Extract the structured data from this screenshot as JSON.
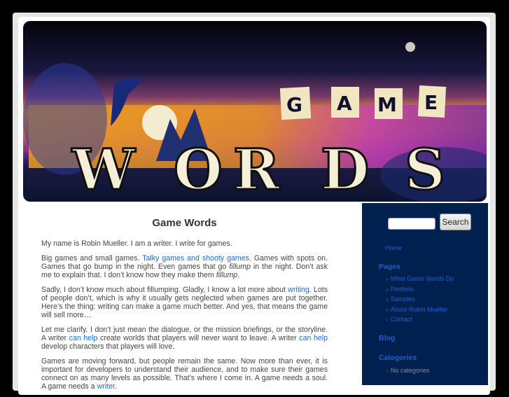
{
  "header": {
    "logo_game_letters": [
      "G",
      "A",
      "M",
      "E"
    ],
    "logo_words": "WORDS"
  },
  "content": {
    "title": "Game Words",
    "p1": "My name is Robin Mueller. I am a writer. I write for games.",
    "p2": {
      "a": "Big games and small games. ",
      "link1": "Talky games and shooty games.",
      "b": " Games with spots on. Games that go bump in the night. Even games that go ",
      "em1": "fillump",
      "c": " in the night. Don’t ask me to explain that. I don’t know how they make them ",
      "em2": "fillump",
      "d": "."
    },
    "p3": {
      "a": "Sadly, I don’t know much about fillumping. Gladly, I know a lot more about ",
      "link1": "writing",
      "b": ". Lots of people don’t, which is why it usually gets neglected when games are put together. Here’s the thing: writing can make a game much better. And yes, that means the game will sell more…"
    },
    "p4": {
      "a": "Let me clarify. I don’t just mean the dialogue, or the mission briefings, or the storyline. A writer ",
      "link1": "can help",
      "b": " create worlds that players will never want to leave. A writer ",
      "link2": "can help",
      "c": " develop characters that players will love."
    },
    "p5": {
      "a": "Games are moving forward, but people remain the same. Now more than ever, it is important for developers to understand their audience, and to make sure their games connect on as many levels as possible. That’s where I come in. A game needs a soul. A game needs a ",
      "link1": "writer",
      "b": "."
    }
  },
  "sidebar": {
    "search_value": "",
    "search_button": "Search",
    "home": "Home",
    "pages_heading": "Pages",
    "pages": [
      "What Game Words Do",
      "Portfolio",
      "Samples",
      "About Robin Mueller",
      "Contact"
    ],
    "blog_heading": "Blog",
    "categories_heading": "Categories",
    "categories": [
      "No categories"
    ],
    "bullet": "»"
  },
  "colors": {
    "sidebar_bg": "#00214f",
    "link": "#1a6ad0",
    "text": "#444444"
  }
}
